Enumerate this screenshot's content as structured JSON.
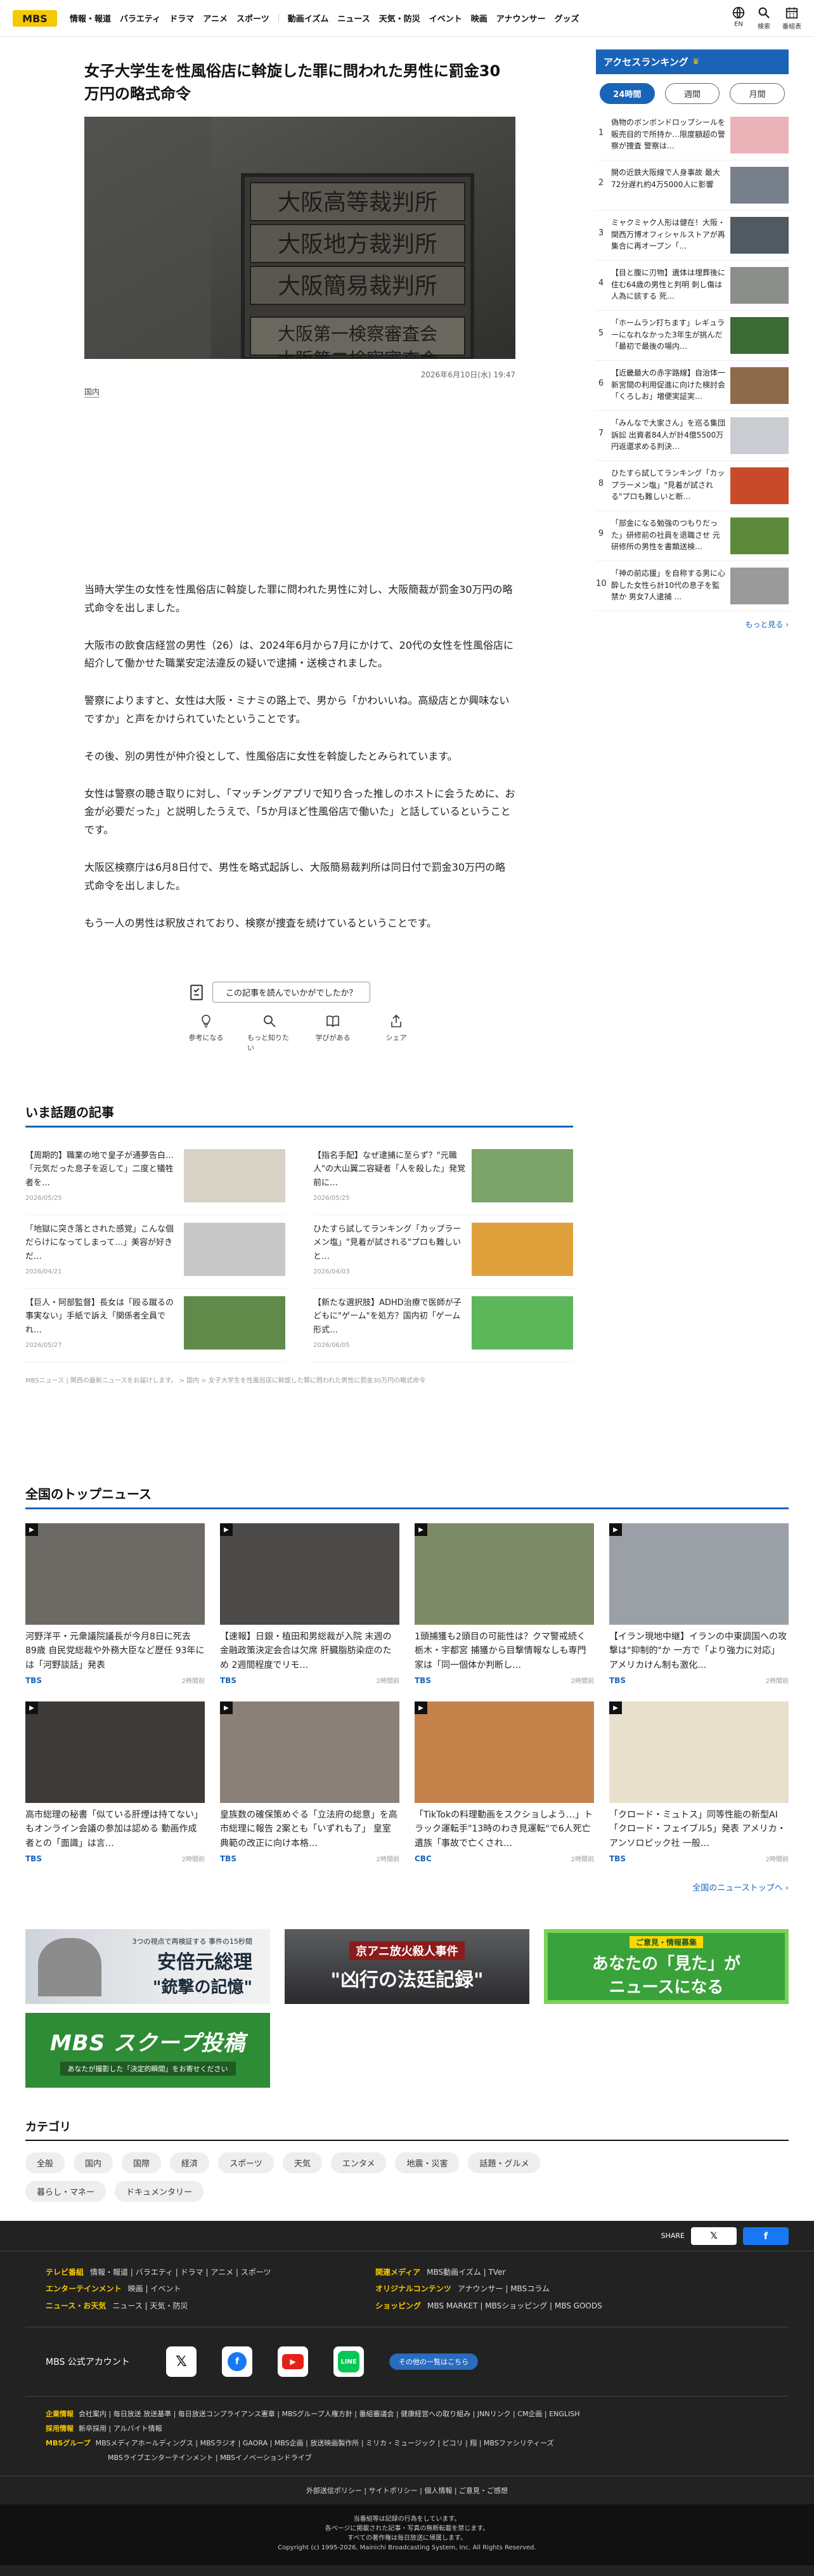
{
  "header": {
    "logo": "MBS",
    "nav": [
      "情報・報道",
      "バラエティ",
      "ドラマ",
      "アニメ",
      "スポーツ",
      "動画イズム",
      "ニュース",
      "天気・防災",
      "イベント",
      "映画",
      "アナウンサー",
      "グッズ"
    ],
    "icons": [
      {
        "name": "EN",
        "label": "EN"
      },
      {
        "name": "search",
        "label": "検索"
      },
      {
        "name": "schedule",
        "label": "番組表"
      }
    ]
  },
  "article": {
    "title": "女子大学生を性風俗店に斡旋した罪に問われた男性に罰金30万円の略式命令",
    "photo_signs": [
      "大阪高等裁判所",
      "大阪地方裁判所",
      "大阪簡易裁判所",
      "大阪第一検察審査会",
      "大阪第二検察審査会"
    ],
    "date": "2026年6月10日(水) 19:47",
    "category": "国内",
    "paragraphs": [
      "当時大学生の女性を性風俗店に斡旋した罪に問われた男性に対し、大阪簡裁が罰金30万円の略式命令を出しました。",
      "大阪市の飲食店経営の男性（26）は、2024年6月から7月にかけて、20代の女性を性風俗店に紹介して働かせた職業安定法違反の疑いで逮捕・送検されました。",
      "警察によりますと、女性は大阪・ミナミの路上で、男から「かわいいね。高級店とか興味ないですか」と声をかけられていたということです。",
      "その後、別の男性が仲介役として、性風俗店に女性を斡旋したとみられています。",
      "女性は警察の聴き取りに対し、「マッチングアプリで知り合った推しのホストに会うために、お金が必要だった」と説明したうえで、「5か月ほど性風俗店で働いた」と話しているということです。",
      "大阪区検察庁は6月8日付で、男性を略式起訴し、大阪簡易裁判所は同日付で罰金30万円の略式命令を出しました。",
      "もう一人の男性は釈放されており、検察が捜査を続けているということです。"
    ],
    "feedback_question": "この記事を読んでいかがでしたか？",
    "reactions": [
      "参考になる",
      "もっと知りたい",
      "学びがある",
      "シェア"
    ]
  },
  "sidebar": {
    "title": "アクセスランキング",
    "tabs": [
      "24時間",
      "週間",
      "月間"
    ],
    "active_tab": 0,
    "ranking": [
      {
        "num": "1",
        "text": "偽物のボンボンドロップシールを販売目的で所持か…限度額超の警察が捜査 警察は…"
      },
      {
        "num": "2",
        "text": "開の近鉄大阪線で人身事故 最大72分遅れ約4万5000人に影響"
      },
      {
        "num": "3",
        "text": "ミャクミャク人形は健在！大阪・関西万博オフィシャルストアが再集合に再オープン「…"
      },
      {
        "num": "4",
        "text": "【目と腹に刃物】遺体は埋葬後に住む64歳の男性と判明 刺し傷は人為に該する 死…"
      },
      {
        "num": "5",
        "text": "「ホームラン打ちます」レギュラーになれなかった3年生が挑んだ「最初で最後の場内…"
      },
      {
        "num": "6",
        "text": "【近畿最大の赤字路線】自治体一新宮間の利用促進に向けた検討会「くろしお」増便実証実…"
      },
      {
        "num": "7",
        "text": "「みんなで大家さん」を巡る集団訴訟 出資者84人が計4億5500万円返還求める判決…"
      },
      {
        "num": "8",
        "text": "ひたすら試してランキング「カップラーメン塩」\"見着が試される\"プロも難しいと断…"
      },
      {
        "num": "9",
        "text": "「部金になる勉強のつもりだった」研修前の社員を退職させ 元研修所の男性を書類送検…"
      },
      {
        "num": "10",
        "text": "「神の前応援」を自称する男に心酔した女性ら計10代の息子を監禁か 男女7人逮捕 …"
      }
    ],
    "more": "もっと見る"
  },
  "hot": {
    "title": "いま話題の記事",
    "items": [
      {
        "text": "【周期的】職業の地で皇子が通夢告白…「元気だった息子を返して」二度と犠牲者を…",
        "date": "2026/05/25"
      },
      {
        "text": "【指名手配】なぜ逮捕に至らず？\"元職人\"の大山翼二容疑者「人を殺した」発覚前に…",
        "date": "2026/05/25"
      },
      {
        "text": "「地獄に突き落とされた感覚」こんな個だらけになってしまって…」美容が好きだ…",
        "date": "2026/04/21"
      },
      {
        "text": "ひたすら試してランキング「カップラーメン塩」\"見着が試される\"プロも難しいと…",
        "date": "2026/04/03"
      },
      {
        "text": "【巨人・阿部監督】長女は「殴る蹴るの事実ない」手紙で訴え「関係者全員でれ…",
        "date": "2026/05/27"
      },
      {
        "text": "【新たな選択肢】ADHD治療で医師が子どもに\"ゲーム\"を処方？国内初「ゲーム形式…",
        "date": "2026/06/05"
      }
    ],
    "breadcrumb": "MBSニュース | 関西の最新ニュースをお届けします。 > 国内 > 女子大学生を性風俗店に斡旋した罪に問われた男性に罰金30万円の略式命令"
  },
  "national": {
    "title": "全国のトップニュース",
    "items": [
      {
        "text": "河野洋平・元衆議院議長が今月8日に死去 89歳 自民党総裁や外務大臣など歴任 93年には「河野談話」発表",
        "src": "TBS",
        "time": "2時間前"
      },
      {
        "text": "【速報】日銀・植田和男総裁が入院 末週の金融政策決定会合は欠席 肝臓脂肪染症のため 2週間程度でリモ…",
        "src": "TBS",
        "time": "2時間前"
      },
      {
        "text": "1頭捕獲も2頭目の可能性は？クマ警戒続く栃木・宇都宮 捕獲から目撃情報なしも専門家は「同一個体か判断し…",
        "src": "TBS",
        "time": "2時間前"
      },
      {
        "text": "【イラン現地中継】イランの中東調国への攻撃は\"抑制的\"か 一方で「より強力に対応」アメリカけん制も激化…",
        "src": "TBS",
        "time": "2時間前"
      },
      {
        "text": "高市総理の秘書「似ている肝煙は持てない」もオンライン会議の参加は認める 動画作成者との「面識」は言…",
        "src": "TBS",
        "time": "2時間前"
      },
      {
        "text": "皇族数の確保策めぐる「立法府の総意」を高市総理に報告 2案とも「いずれも了」 皇室典範の改正に向け本格…",
        "src": "TBS",
        "time": "2時間前"
      },
      {
        "text": "「TikTokの料理動画をスクショしよう…」トラック運転手\"13時のわき見運転\"で6人死亡 遺族「事故で亡くされ…",
        "src": "CBC",
        "time": "2時間前"
      },
      {
        "text": "「クロード・ミュトス」同等性能の新型AI「クロード・フェイブル5」発表 アメリカ・アンソロピック社 一般…",
        "src": "TBS",
        "time": "2時間前"
      }
    ],
    "more": "全国のニューストップへ"
  },
  "banners": [
    {
      "line1": "3つの視点で再検証する 事件の15秒間",
      "line2": "安倍元総理",
      "line3": "\"銃撃の記憶\""
    },
    {
      "line1": "京アニ放火殺人事件",
      "line2": "\"凶行の法廷記録\"",
      "line3": ""
    },
    {
      "line1": "ご意見・情報募集",
      "line2": "あなたの「見た」が",
      "line3": "ニュースになる"
    },
    {
      "line1": "MBS スクープ投稿",
      "line2": "あなたが撮影した「決定的瞬間」をお寄せください",
      "line3": ""
    }
  ],
  "category": {
    "title": "カテゴリ",
    "chips": [
      "全般",
      "国内",
      "国際",
      "経済",
      "スポーツ",
      "天気",
      "エンタメ",
      "地震・災害",
      "話題・グルメ",
      "暮らし・マネー",
      "ドキュメンタリー"
    ]
  },
  "footer": {
    "share": "SHARE",
    "links": [
      {
        "label": "テレビ番組",
        "items": "情報・報道 | バラエティ | ドラマ | アニメ | スポーツ",
        "label2": "関連メディア",
        "items2": "MBS動画イズム | TVer"
      },
      {
        "label": "エンターテインメント",
        "items": "映画 | イベント",
        "label2": "オリジナルコンテンツ",
        "items2": "アナウンサー | MBSコラム"
      },
      {
        "label": "ニュース・お天気",
        "items": "ニュース | 天気・防災",
        "label2": "ショッピング",
        "items2": "MBS MARKET | MBSショッピング | MBS GOODS"
      }
    ],
    "official": "MBS 公式アカウント",
    "other": "その他の一覧はこちら",
    "group": [
      {
        "label": "企業情報",
        "items": "会社案内 | 毎日放送 放送基準 | 毎日放送コンプライアンス憲章 | MBSグループ人権方針 | 番組審議会 | 健康経営への取り組み | JNNリンク | CM企画 | ENGLISH"
      },
      {
        "label": "採用情報",
        "items": "新卒採用 | アルバイト情報"
      },
      {
        "label": "MBSグループ",
        "items": "MBSメディアホールディングス | MBSラジオ | GAORA | MBS企画 | 放送映画製作所 | ミリカ・ミュージック | ピコリ | 翔 | MBSファシリティーズ"
      },
      {
        "label": "",
        "items": "MBSライブエンターテインメント | MBSイノベーションドライブ"
      }
    ],
    "policies": "外部送信ポリシー | サイトポリシー | 個人情報 | ご意見・ご感想",
    "copyright": [
      "当番組等は記録の行為をしています。",
      "各ページに掲載された記事・写真の無断転載を禁じます。",
      "すべての著作権は毎日放送に帰属します。",
      "Copyright (c) 1995-2026, Mainichi Broadcasting System, Inc. All Rights Reserved."
    ]
  }
}
